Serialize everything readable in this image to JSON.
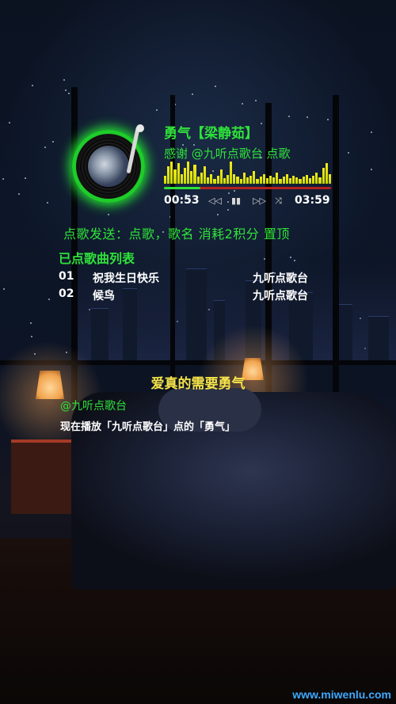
{
  "now_playing": {
    "title": "勇气【梁静茹】",
    "dedication": "感谢 @九听点歌台 点歌",
    "elapsed": "00:53",
    "duration": "03:59",
    "progress": 0.22
  },
  "controls": {
    "prev_icon": "prev-icon",
    "pause_icon": "pause-icon",
    "next_icon": "next-icon",
    "shuffle_icon": "shuffle-icon"
  },
  "hint_text": "点歌发送：点歌，歌名  消耗2积分  置顶",
  "playlist": {
    "title": "已点歌曲列表",
    "items": [
      {
        "index": "01",
        "song": "祝我生日快乐",
        "requester": "九听点歌台"
      },
      {
        "index": "02",
        "song": "候鸟",
        "requester": "九听点歌台"
      }
    ]
  },
  "lyric": "爱真的需要勇气",
  "announcement": {
    "mention": "@九听点歌台",
    "message": "现在播放「九听点歌台」点的「勇气」"
  },
  "watermark": "www.miwenlu.com",
  "colors": {
    "accent_green": "#2fe23a",
    "lyric_yellow": "#f5e34a",
    "progress_red": "#b42020",
    "watermark_blue": "#3da8ff"
  }
}
